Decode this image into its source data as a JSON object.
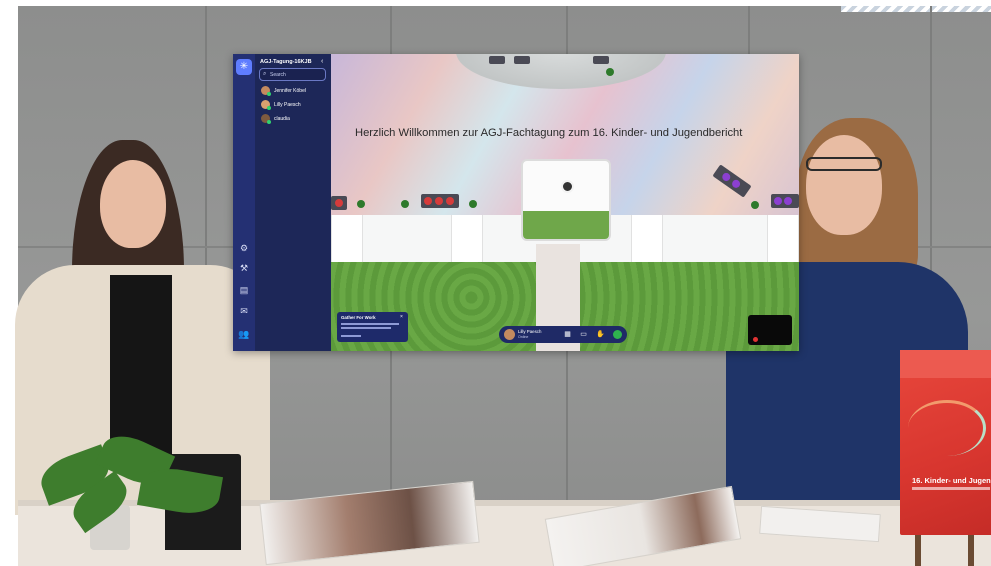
{
  "screen": {
    "room_name": "AGJ-Tagung-16KJB",
    "search": {
      "placeholder": "Search"
    },
    "users": [
      {
        "name": "Jennifer Köbel"
      },
      {
        "name": "Lilly Paesch"
      },
      {
        "name": "claudia"
      }
    ],
    "welcome_text": "Herzlich Willkommen zur AGJ-Fachtagung zum 16. Kinder- und Jugendbericht",
    "toast": {
      "title": "Gather For Work"
    },
    "dock": {
      "name": "Lilly Paesch",
      "status": "Online"
    },
    "icons": {
      "rail": [
        "settings-icon",
        "build-icon",
        "calendar-icon",
        "chat-icon",
        "people-icon"
      ],
      "dock": [
        "map-icon",
        "screen-share-icon",
        "hand-icon",
        "status-icon"
      ]
    }
  },
  "book": {
    "title": "16. Kinder- und Jugen"
  },
  "colors": {
    "sidebar": "#1d2758",
    "rail": "#243073",
    "grass": "#5c9a3b",
    "book": "#d8362f"
  }
}
